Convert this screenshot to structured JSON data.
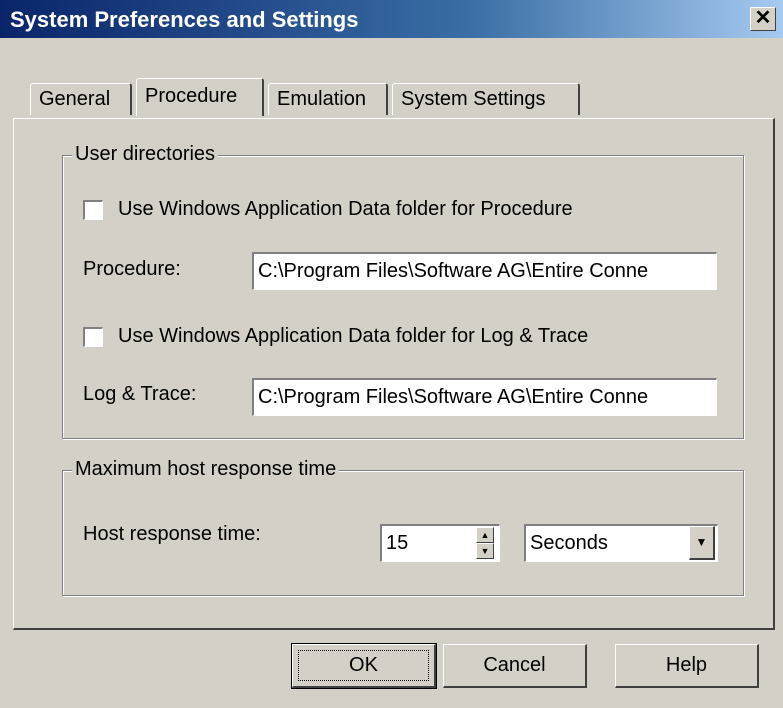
{
  "window": {
    "title": "System Preferences and Settings",
    "close_glyph": "✕"
  },
  "tabs": [
    {
      "label": "General",
      "active": false
    },
    {
      "label": "Procedure",
      "active": true
    },
    {
      "label": "Emulation",
      "active": false
    },
    {
      "label": "System Settings",
      "active": false
    }
  ],
  "user_directories": {
    "legend": "User directories",
    "procedure_checkbox": {
      "label": "Use Windows Application Data folder for Procedure",
      "checked": false
    },
    "procedure": {
      "label": "Procedure:",
      "value": "C:\\Program Files\\Software AG\\Entire Conne"
    },
    "log_checkbox": {
      "label": "Use Windows Application Data folder for Log & Trace",
      "checked": false
    },
    "log_trace": {
      "label": "Log & Trace:",
      "value": "C:\\Program Files\\Software AG\\Entire Conne"
    }
  },
  "response_time": {
    "legend": "Maximum host response time",
    "label": "Host response time:",
    "value": "15",
    "unit": "Seconds"
  },
  "buttons": {
    "ok": "OK",
    "cancel": "Cancel",
    "help": "Help"
  }
}
